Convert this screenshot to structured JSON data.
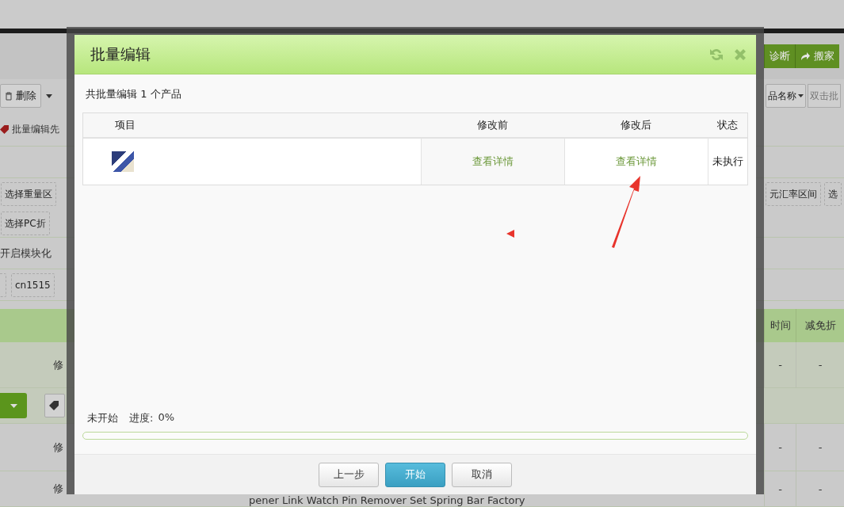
{
  "background_page": {
    "toolbar_buttons": [
      {
        "label": "诊断",
        "kind": "plain"
      },
      {
        "label": "搬家",
        "kind": "share"
      }
    ],
    "delete_button": "删除",
    "search_type_dropdown": "品名称",
    "search_placeholder": "双击批",
    "batch_edit_tag": "批量编辑先",
    "filter_chips_left": [
      "选择重量区",
      "选择PC折"
    ],
    "filter_chips_right": [
      "元汇率区间",
      "选"
    ],
    "modular_label": "开启模块化",
    "id_chip": "cn1515",
    "table_columns": [
      "时间",
      "减免折"
    ],
    "rows": [
      {
        "column_1": "修",
        "column_2": "-",
        "column_3": "-"
      },
      {
        "column_1": "修",
        "column_2": "-",
        "column_3": "-"
      },
      {
        "column_1": "修",
        "column_2": "-",
        "column_3": "-",
        "title": "pener Link Watch Pin Remover Set Spring Bar Factory"
      }
    ]
  },
  "dialog": {
    "title": "批量编辑",
    "summary": "共批量编辑 1 个产品",
    "columns": [
      "项目",
      "修改前",
      "修改后",
      "状态"
    ],
    "rows": [
      {
        "before": "查看详情",
        "after": "查看详情",
        "status": "未执行"
      }
    ],
    "progress": {
      "status": "未开始",
      "label": "进度:",
      "percent": "0%",
      "level": 0
    },
    "buttons": [
      {
        "label": "上一步",
        "kind": "default"
      },
      {
        "label": "开始",
        "kind": "primary"
      },
      {
        "label": "取消",
        "kind": "default"
      }
    ]
  }
}
